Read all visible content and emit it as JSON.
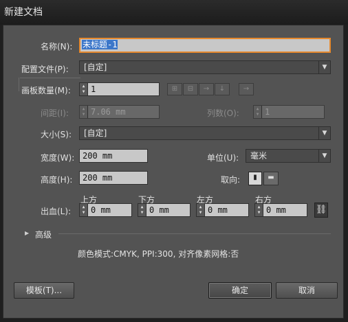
{
  "window": {
    "title": "新建文档"
  },
  "name": {
    "label": "名称(N):",
    "value": "未标题-1"
  },
  "profile": {
    "label": "配置文件(P):",
    "value": "[自定]"
  },
  "artboards": {
    "label": "画板数量(M):",
    "value": "1",
    "spacing_label": "间距(I):",
    "spacing_value": "7.06 mm",
    "columns_label": "列数(O):",
    "columns_value": "1",
    "arrange_icons": [
      "grid-by-row-icon",
      "grid-by-column-icon",
      "arrange-by-row-icon",
      "arrange-by-column-icon"
    ],
    "direction_icon": "right-to-left-arrow-icon"
  },
  "size": {
    "label": "大小(S):",
    "value": "[自定]"
  },
  "width": {
    "label": "宽度(W):",
    "value": "200 mm"
  },
  "units": {
    "label": "单位(U):",
    "value": "毫米"
  },
  "height": {
    "label": "高度(H):",
    "value": "200 mm"
  },
  "orientation": {
    "label": "取向:",
    "options": [
      "portrait-icon",
      "landscape-icon"
    ]
  },
  "bleed": {
    "label": "出血(L):",
    "top_label": "上方",
    "top": "0 mm",
    "bottom_label": "下方",
    "bottom": "0 mm",
    "left_label": "左方",
    "left": "0 mm",
    "right_label": "右方",
    "right": "0 mm",
    "link_icon": "chain-link-icon"
  },
  "advanced": {
    "label": "高级"
  },
  "info": "颜色模式:CMYK, PPI:300, 对齐像素网格:否",
  "buttons": {
    "templates": "模板(T)...",
    "ok": "确定",
    "cancel": "取消"
  },
  "colors": {
    "dialog_bg": "#535353",
    "focus_outline": "#e6892d",
    "selection": "#3b76c9"
  }
}
